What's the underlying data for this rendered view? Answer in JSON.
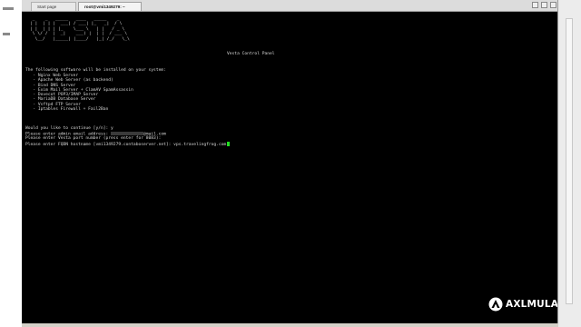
{
  "browser": {
    "tabs": [
      {
        "label": "Start page"
      },
      {
        "label": "root@vmi1349279: ~"
      }
    ]
  },
  "terminal": {
    "logo_lines": [
      "  _    _   _____   ____   _____    _",
      " | |  | | |  ___| / ___| |_   _|  / \\",
      " | |  | | | |_    \\___ \\   | |   / _ \\",
      "  \\ \\/ /  |  _|    ___) |  | |  / ___ \\",
      "   \\__/   |_____| |____/   |_| /_/   \\_\\"
    ],
    "subtitle": "Vesta Control Panel",
    "intro": "The following software will be installed on your system:",
    "software": [
      "   - Nginx Web Server",
      "   - Apache Web Server (as backend)",
      "   - Bind DNS Server",
      "   - Exim Mail Server + ClamAV SpamAssassin",
      "   - Dovecot POP3/IMAP Server",
      "   - MariaDB Database Server",
      "   - Vsftpd FTP Server",
      "   - Iptables Firewall + Fail2Ban"
    ],
    "prompt_continue": "Would you like to continue [y/n]: y",
    "prompt_email_prefix": "Please enter admin email address: ",
    "prompt_email_suffix": "@mail.com",
    "prompt_port": "Please enter Vesta port number (press enter for 8083):",
    "prompt_fqdn": "Please enter FQDN hostname [vmi1349279.contaboserver.net]: vps.travelingfrog.com",
    "cursor_color": "#22dd22"
  },
  "watermark": {
    "text": "AXLMULAT.COM"
  }
}
